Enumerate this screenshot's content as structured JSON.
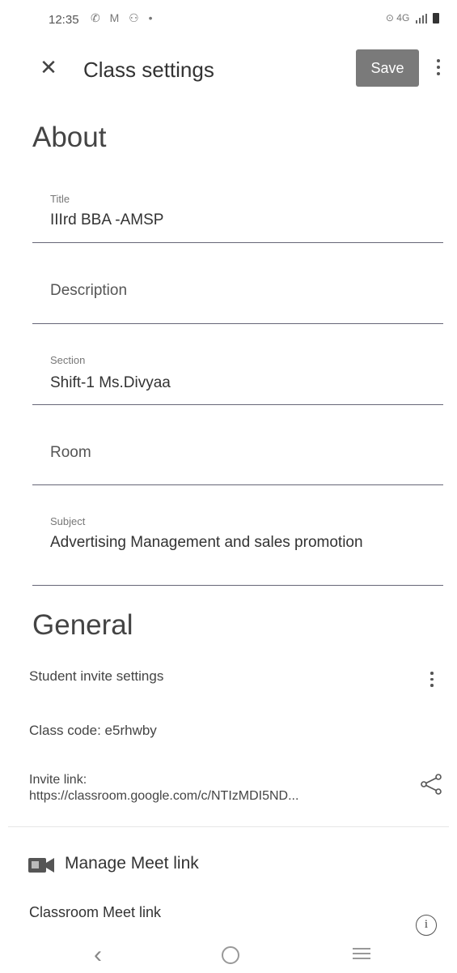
{
  "status_bar": {
    "time": "12:35",
    "left_icons": "✆ M ⚇ •",
    "right_text": "⊙ 4G"
  },
  "header": {
    "title": "Class settings",
    "save_label": "Save",
    "close_glyph": "✕"
  },
  "about": {
    "heading": "About",
    "fields": [
      {
        "label": "Title",
        "value": "IIIrd BBA -AMSP"
      },
      {
        "placeholder": "Description"
      },
      {
        "label": "Section",
        "value": "Shift-1 Ms.Divyaa"
      },
      {
        "placeholder": "Room"
      },
      {
        "label": "Subject",
        "value": "Advertising Management and sales promotion"
      }
    ]
  },
  "general": {
    "heading": "General",
    "student_invite_settings": "Student invite settings",
    "class_code": "Class code: e5rhwby",
    "invite_label": "Invite link:",
    "invite_url": "https://classroom.google.com/c/NTIzMDI5ND..."
  },
  "meet": {
    "title": "Manage Meet link",
    "classroom_meet_link": "Classroom Meet link"
  },
  "nav": {
    "back_glyph": "‹"
  },
  "colors": {
    "save_button_bg": "#7a7a7a",
    "field_underline": "#667788",
    "meet_icon": "#555555"
  },
  "icons": [
    "close-icon",
    "more-vert-icon",
    "share-icon",
    "meet-icon",
    "info-icon",
    "back-icon",
    "home-icon",
    "recents-icon"
  ]
}
